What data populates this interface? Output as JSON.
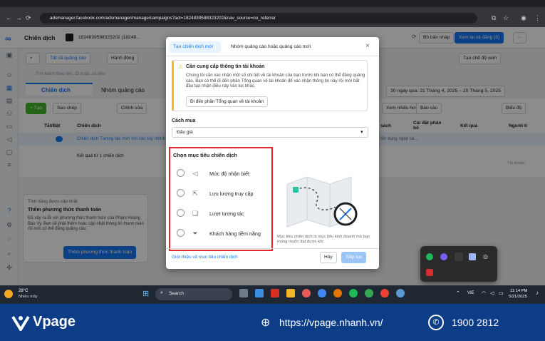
{
  "browser": {
    "url": "adsmanager.facebook.com/adsmanager/manage/campaigns?act=1824839588323202&nav_source=no_referrer"
  },
  "header": {
    "title": "Chiến dịch",
    "account": "1824839588323202 (18248...",
    "save_draft": "Bỏ bản nháp",
    "review_publish": "Xem lại và đăng (3)"
  },
  "toolbar": {
    "all_campaigns": "Tất cả quảng cáo",
    "activity": "Hành động",
    "create_view": "Tạo chế độ xem",
    "search_placeholder": "Tìm kiếm theo tên, ID hoặc số liệu",
    "date_range": "30 ngày qua: 21 Tháng 4, 2025 – 20 Tháng 5, 2025"
  },
  "tabs": {
    "campaigns": "Chiến dịch",
    "adsets": "Nhóm quảng cáo"
  },
  "actions": {
    "create": "+ Tạo",
    "duplicate": "Sao chép",
    "edit": "Chỉnh sửa",
    "more": "Xem nhiều hơn",
    "reports": "Báo cáo",
    "breakdown": "Biểu đồ"
  },
  "table": {
    "headers": [
      "Tắt/Bật",
      "Chiến dịch",
      "sách",
      "Cài đặt phân bổ",
      "Kết quả",
      "Người ti"
    ],
    "row_name": "Chiến dịch Tương tác mới với các tùy chỉnh",
    "row_budget": "Sử dụng ngân sá...",
    "row_result": "—",
    "summary": "Kết quả từ 1 chiến dịch",
    "excluded": "Tài khoản"
  },
  "notice": {
    "title_small": "Tình năng được cập nhật",
    "title": "Thêm phương thức thanh toán",
    "body": "Đã xảy ra lỗi với phương thức thanh toán của Phạm Hoàng Bảo Vy. Bạn sẽ phải thêm hoặc cập nhật thông tin thanh toán rồi mới có thể đăng quảng cáo.",
    "button": "Thêm phương thức thanh toán"
  },
  "modal": {
    "tab_new": "Tạo chiến dịch mới",
    "tab_existing": "Nhóm quảng cáo hoặc quảng cáo mới",
    "warning_title": "Cần cung cấp thông tin tài khoản",
    "warning_body": "Chúng tôi cần xác nhận một số chi tiết về tài khoản của bạn trước khi bạn có thể đăng quảng cáo. Bạn có thể đi đến phần Tổng quan về tài khoản để xác nhận thông tin này rồi mới bắt đầu tạo nhận điều này vào lúc khác.",
    "warning_button": "Đi đến phần Tổng quan về tài khoản",
    "buy_type_label": "Cách mua",
    "buy_type_value": "Đấu giá",
    "objective_label": "Chọn mục tiêu chiến dịch",
    "objectives": [
      "Mức độ nhận biết",
      "Lưu lượng truy cập",
      "Lượt tương tác",
      "Khách hàng tiềm năng"
    ],
    "illustration_caption": "Mục tiêu chiến dịch là mục tiêu kinh doanh mà bạn mong muốn đạt được khi",
    "learn_link": "Giới thiệu về mục tiêu chiến dịch",
    "cancel": "Hủy",
    "continue": "Tiếp tục"
  },
  "taskbar": {
    "weather_temp": "28°C",
    "weather_desc": "Nhiều mây",
    "search": "Search",
    "lang": "VIE",
    "time": "11:14 PM",
    "date": "5/21/2025"
  },
  "banner": {
    "brand": "Vpage",
    "website": "https://vpage.nhanh.vn/",
    "phone": "1900 2812"
  },
  "colors": {
    "fb_blue": "#1877f2",
    "warning_orange": "#f7b928",
    "highlight_red": "#e0292f",
    "banner_navy": "#0d3d87"
  }
}
